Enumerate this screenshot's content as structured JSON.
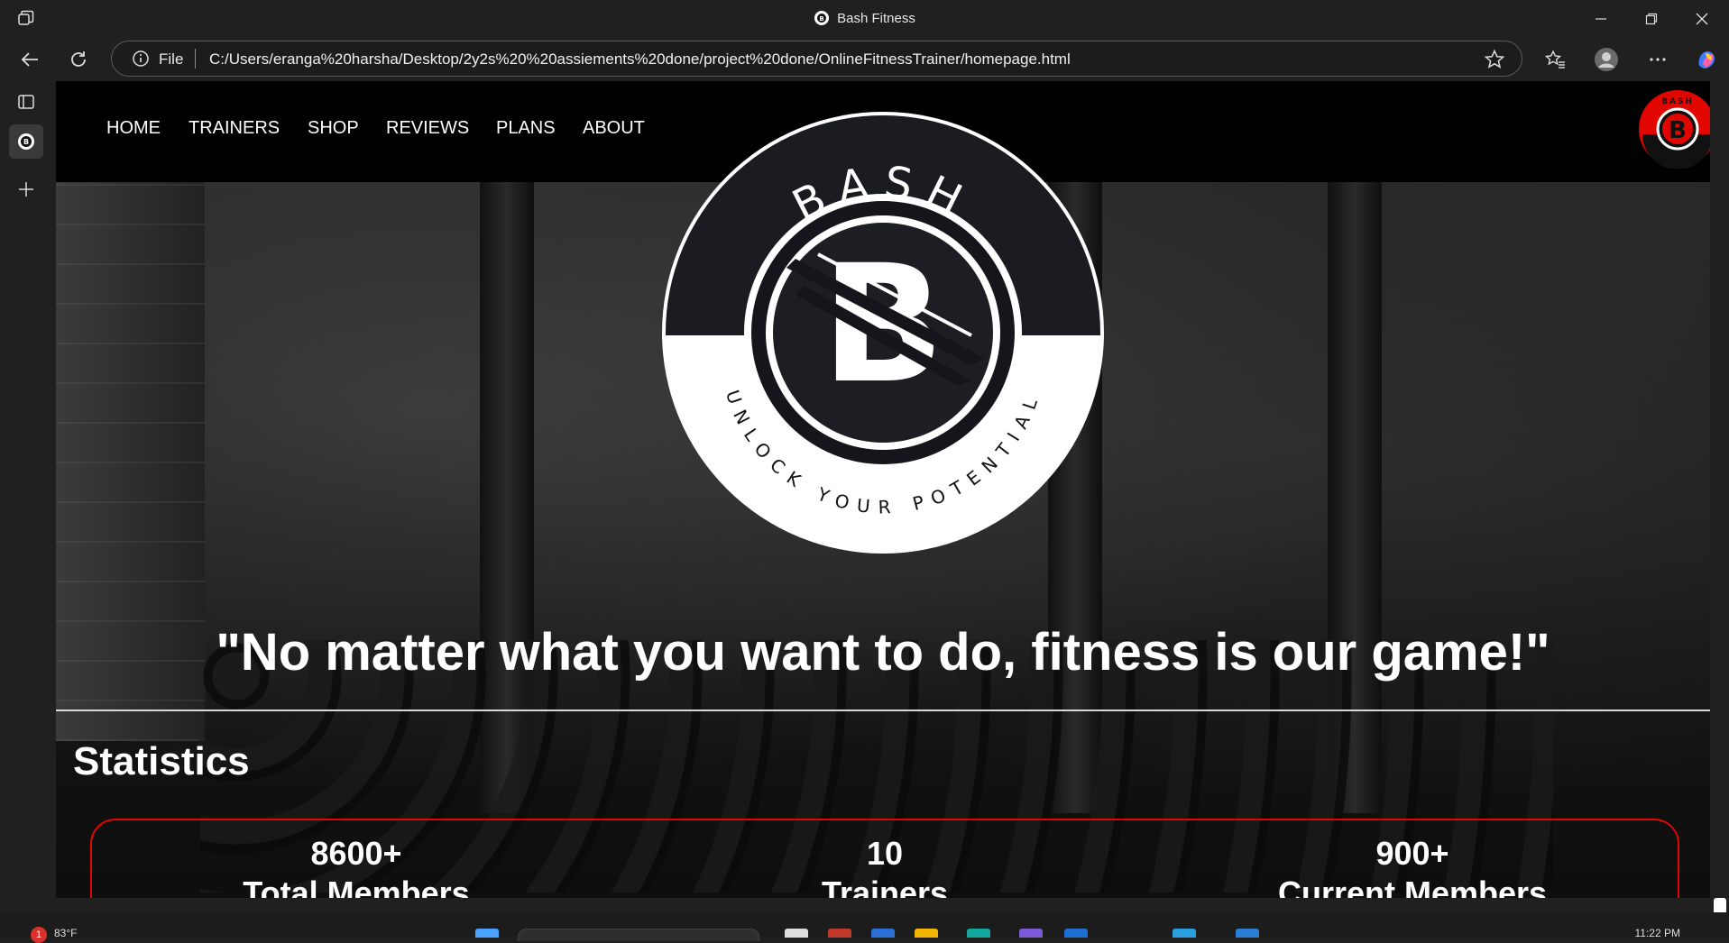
{
  "browser": {
    "window_title": "Bash Fitness",
    "address_scheme": "File",
    "url": "C:/Users/eranga%20harsha/Desktop/2y2s%20%20assiements%20done/project%20done/OnlineFitnessTrainer/homepage.html"
  },
  "page": {
    "nav": {
      "items": [
        {
          "label": "HOME"
        },
        {
          "label": "TRAINERS"
        },
        {
          "label": "SHOP"
        },
        {
          "label": "REVIEWS"
        },
        {
          "label": "PLANS"
        },
        {
          "label": "ABOUT"
        }
      ]
    },
    "logo": {
      "wordmark": "BASH",
      "letter": "B",
      "tagline": "UNLOCK YOUR POTENTIAL"
    },
    "quote": "\"No matter what you want to do, fitness is our game!\"",
    "stats": {
      "heading": "Statistics",
      "items": [
        {
          "value": "8600+",
          "label": "Total Members"
        },
        {
          "value": "10",
          "label": "Trainers"
        },
        {
          "value": "900+",
          "label": "Current Members"
        }
      ]
    }
  },
  "taskbar": {
    "temperature": "83°F",
    "notification_count": "1",
    "time": "11:22 PM"
  },
  "colors": {
    "accent_red": "#e10600",
    "navbar": "#000000",
    "chrome": "#202020"
  }
}
